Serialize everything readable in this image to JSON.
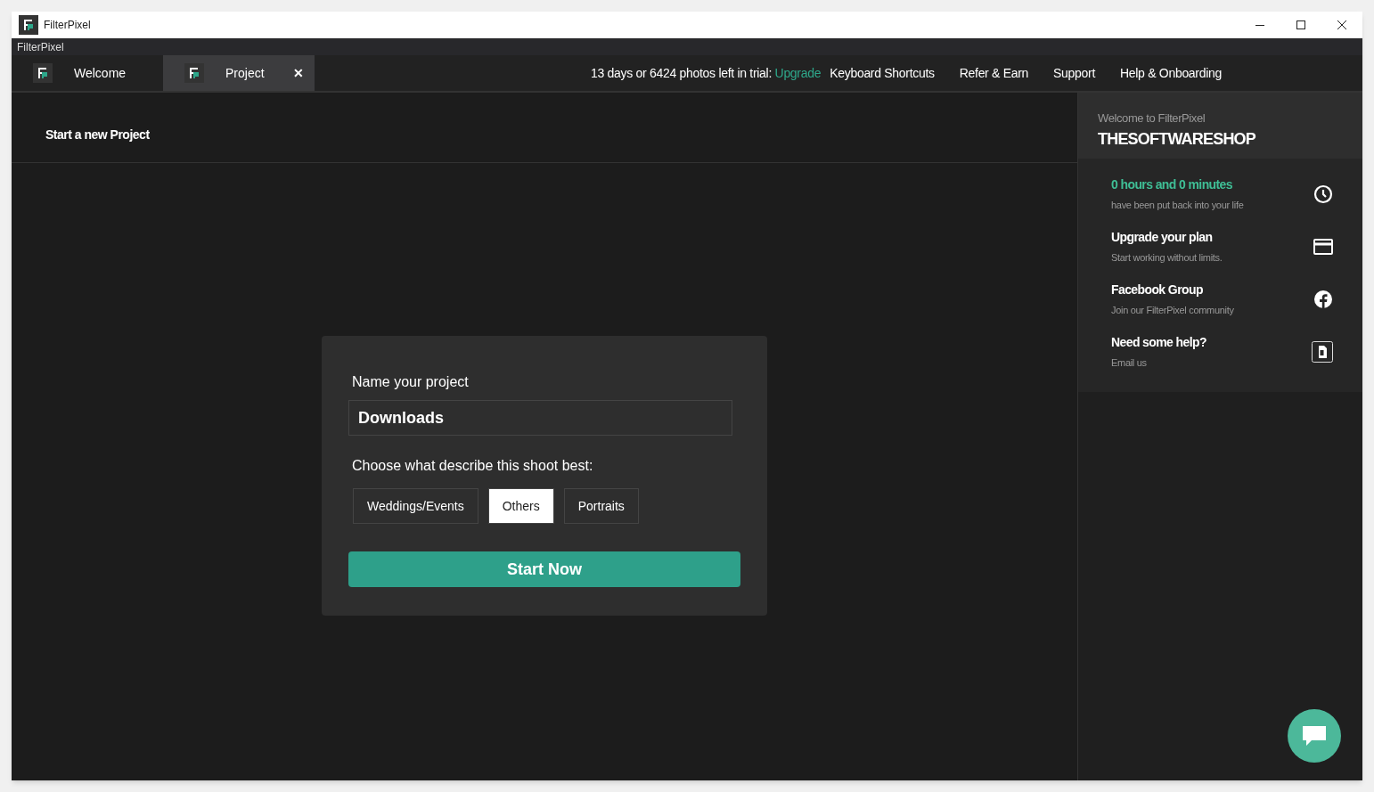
{
  "window": {
    "title": "FilterPixel"
  },
  "menu_label": "FilterPixel",
  "tabs": [
    {
      "label": "Welcome",
      "selected": false,
      "closable": false
    },
    {
      "label": "Project",
      "selected": true,
      "closable": true
    }
  ],
  "close_tab_glyph": "✕",
  "trial": {
    "text": "13 days or 6424 photos left in trial:",
    "link": "Upgrade"
  },
  "nav_links": [
    "Keyboard Shortcuts",
    "Refer & Earn",
    "Support",
    "Help & Onboarding"
  ],
  "page_title": "Start a new Project",
  "form": {
    "name_label": "Name your project",
    "name_value": "Downloads",
    "choice_label": "Choose what describe this shoot best:",
    "options": [
      {
        "label": "Weddings/Events",
        "selected": false
      },
      {
        "label": "Others",
        "selected": true
      },
      {
        "label": "Portraits",
        "selected": false
      }
    ],
    "submit": "Start Now"
  },
  "sidebar": {
    "greeting": "Welcome to FilterPixel",
    "user": "THESOFTWARESHOP",
    "items": [
      {
        "kind": "clock",
        "title": "0 hours and 0 minutes",
        "subtitle": "have been put back into your life",
        "highlight": true
      },
      {
        "kind": "card",
        "title": "Upgrade your plan",
        "subtitle": "Start working without limits.",
        "highlight": false
      },
      {
        "kind": "facebook",
        "title": "Facebook Group",
        "subtitle": "Join our FilterPixel community",
        "highlight": false
      },
      {
        "kind": "document",
        "title": "Need some help?",
        "subtitle": "Email us",
        "highlight": false
      }
    ]
  }
}
